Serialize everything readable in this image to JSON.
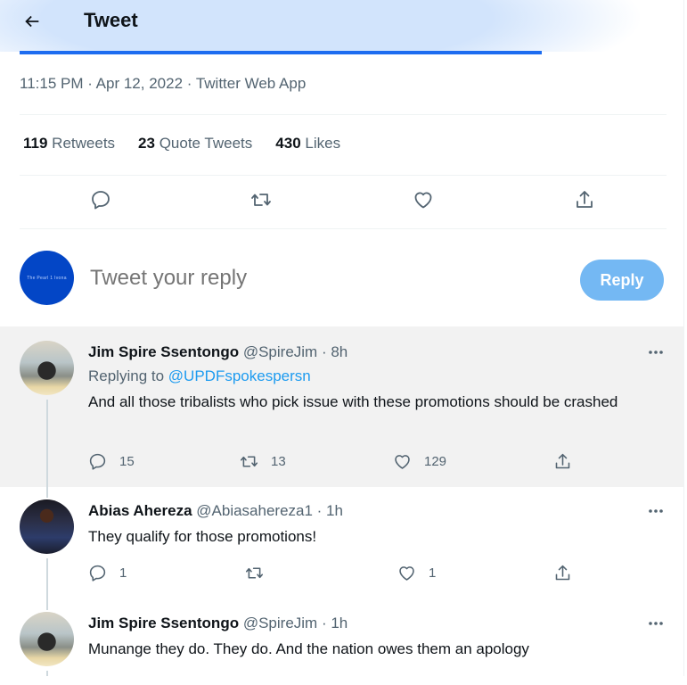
{
  "header": {
    "title": "Tweet",
    "back_icon": "arrow-left-icon"
  },
  "tweet": {
    "meta": "11:15 PM · Apr 12, 2022 · Twitter Web App",
    "stats": [
      {
        "count": "119",
        "label": "Retweets"
      },
      {
        "count": "23",
        "label": "Quote Tweets"
      },
      {
        "count": "430",
        "label": "Likes"
      }
    ],
    "actions": [
      "reply-icon",
      "retweet-icon",
      "like-icon",
      "share-icon"
    ]
  },
  "compose": {
    "avatar_text": "The Pearl 1 Ivona",
    "placeholder": "Tweet your reply",
    "button_label": "Reply",
    "button_color": "#74b8f3"
  },
  "replies": [
    {
      "name": "Jim Spire Ssentongo",
      "handle": "@SpireJim",
      "time": "· 8h",
      "replying_prefix": "Replying to",
      "replying_to": "@UPDFspokespersn",
      "text": "And all those tribalists who pick issue with these promotions should be crashed",
      "counts": {
        "reply": "15",
        "retweet": "13",
        "like": "129"
      }
    },
    {
      "name": "Abias Ahereza",
      "handle": "@Abiasahereza1",
      "time": "· 1h",
      "text": "They qualify for those promotions!",
      "counts": {
        "reply": "1",
        "retweet": "",
        "like": "1"
      }
    },
    {
      "name": "Jim Spire Ssentongo",
      "handle": "@SpireJim",
      "time": "· 1h",
      "text": "Munange they do. They do. And the nation owes them an apology"
    }
  ],
  "colors": {
    "accent": "#1d9bf0",
    "muted": "#536471",
    "text": "#0f1419",
    "highlight_bg": "#f2f2f2"
  }
}
